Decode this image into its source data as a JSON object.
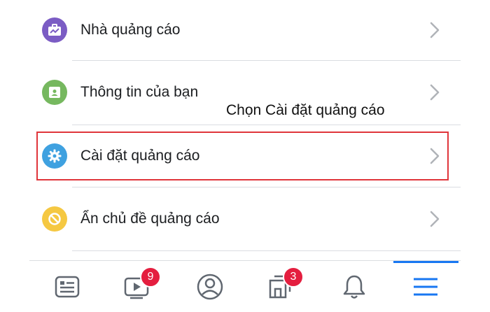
{
  "menu": {
    "items": [
      {
        "label": "Nhà quảng cáo",
        "icon": "briefcase-icon",
        "color": "#7b5cc4"
      },
      {
        "label": "Thông tin của bạn",
        "icon": "id-card-icon",
        "color": "#76b85f"
      },
      {
        "label": "Cài đặt quảng cáo",
        "icon": "gear-icon",
        "color": "#3fa1e0"
      },
      {
        "label": "Ẩn chủ đề quảng cáo",
        "icon": "block-icon",
        "color": "#f5c842"
      }
    ]
  },
  "annotation": {
    "text": "Chọn Cài đặt quảng cáo",
    "highlight_color": "#e0353b"
  },
  "tabbar": {
    "tabs": [
      {
        "name": "news-feed",
        "icon": "news-feed-icon"
      },
      {
        "name": "watch",
        "icon": "video-icon",
        "badge": "9"
      },
      {
        "name": "profile",
        "icon": "profile-icon"
      },
      {
        "name": "pages",
        "icon": "pages-icon",
        "badge": "3"
      },
      {
        "name": "notifications",
        "icon": "bell-icon"
      },
      {
        "name": "menu",
        "icon": "hamburger-menu-icon",
        "active": true
      }
    ],
    "accent": "#1877f2"
  }
}
